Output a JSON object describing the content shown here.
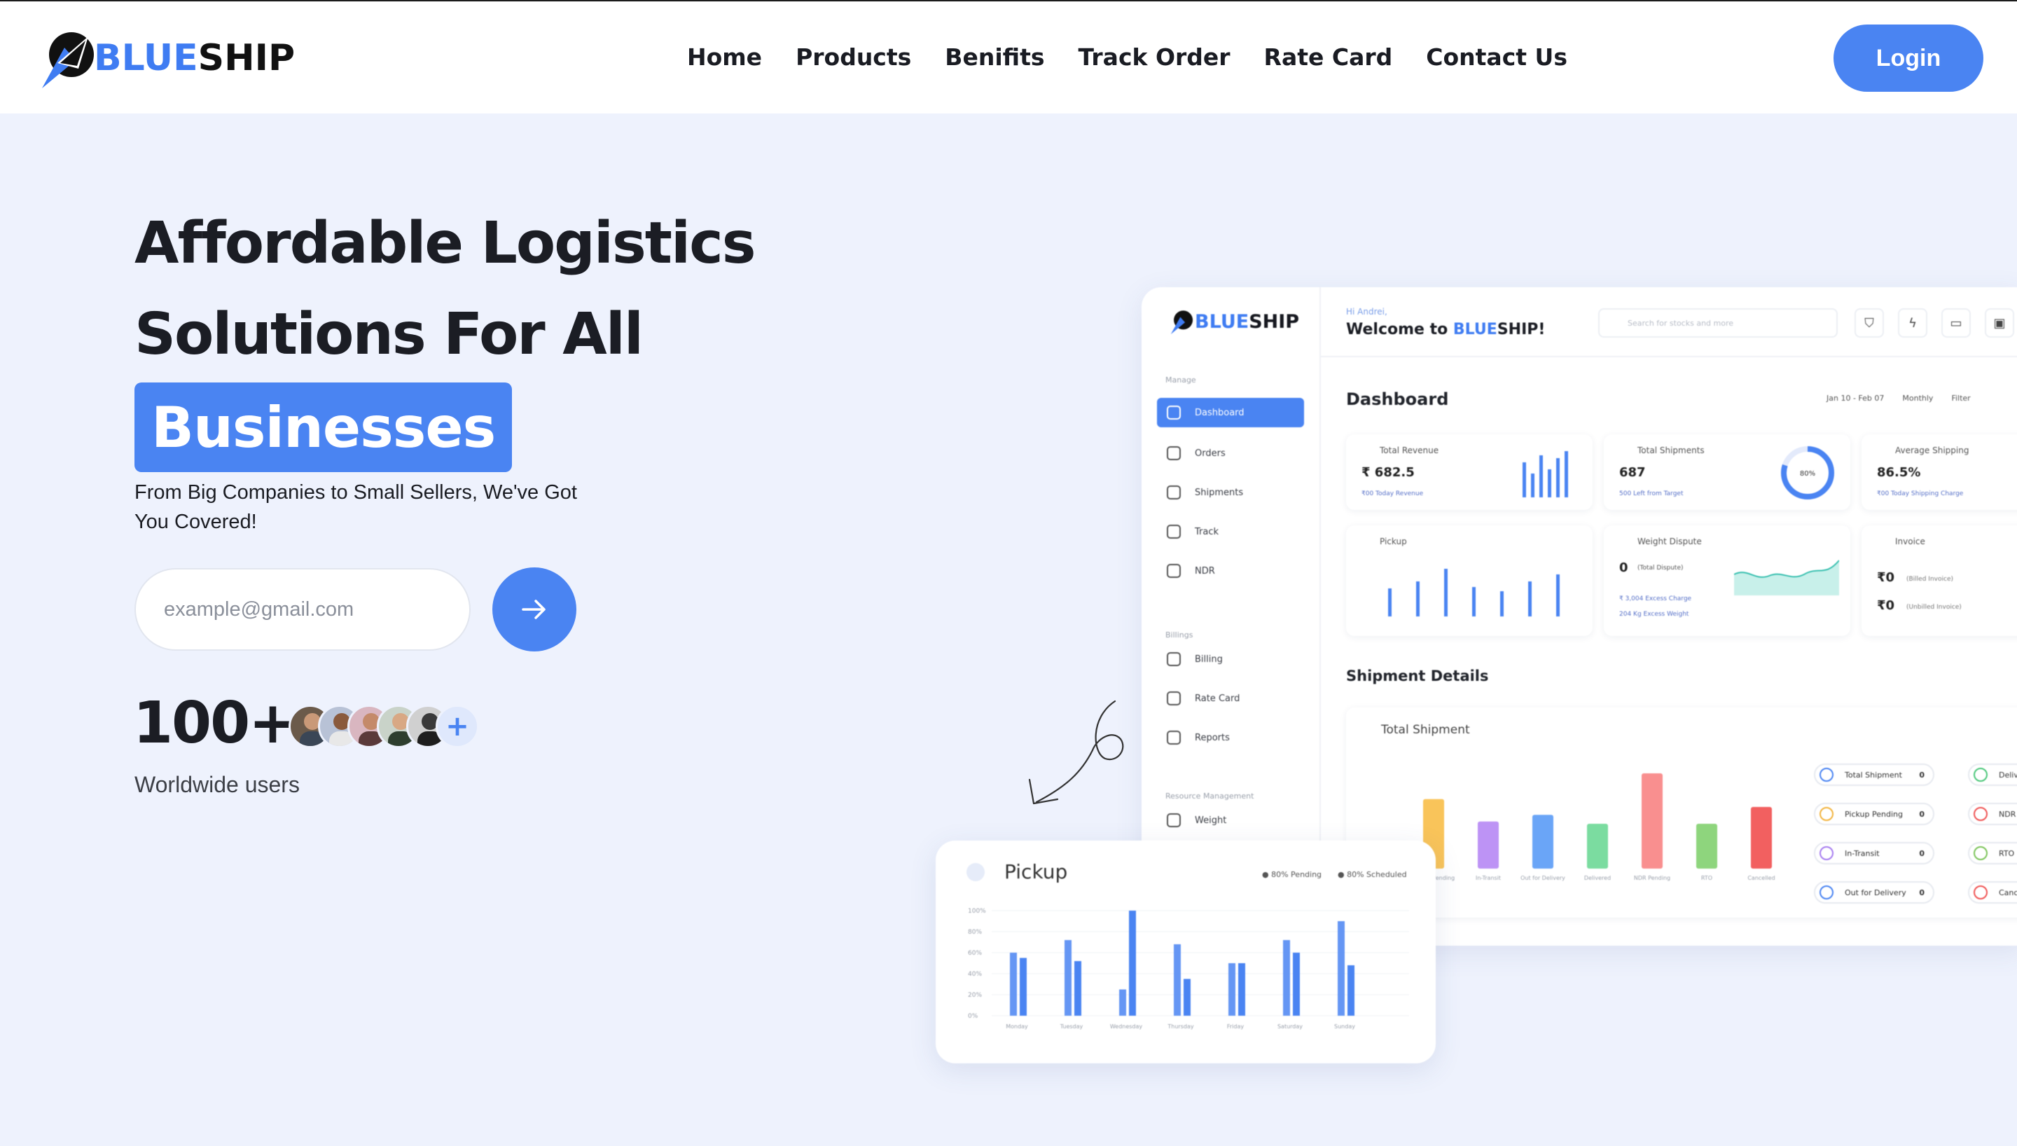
{
  "brand": {
    "part1": "BLUE",
    "part2": "SHIP",
    "accent": "#4a84f2"
  },
  "nav": {
    "items": [
      "Home",
      "Products",
      "Benifits",
      "Track Order",
      "Rate Card",
      "Contact Us"
    ],
    "login": "Login"
  },
  "hero": {
    "line1": "Affordable Logistics",
    "line2": "Solutions For All",
    "highlight": "Businesses",
    "subtitle": "From Big Companies to Small Sellers, We've Got You Covered!",
    "email_placeholder": "example@gmail.com",
    "users_count": "100+",
    "users_label": "Worldwide users",
    "avatar_plus": "+"
  },
  "dashboard": {
    "greeting": "Hi Andrei,",
    "welcome_prefix": "Welcome to ",
    "welcome_brand_blue": "BLUE",
    "welcome_brand_dark": "SHIP!",
    "search_placeholder": "Search for stocks and more",
    "title": "Dashboard",
    "date_range": "Jan 10 - Feb 07",
    "period": "Monthly",
    "filter": "Filter",
    "sidebar": {
      "manage_label": "Manage",
      "items": [
        "Dashboard",
        "Orders",
        "Shipments",
        "Track",
        "NDR"
      ],
      "billings_label": "Billings",
      "billing_items": [
        "Billing",
        "Rate Card",
        "Reports"
      ],
      "resource_label": "Resource Management",
      "resource_items": [
        "Weight"
      ]
    },
    "cards": [
      {
        "label": "Total Revenue",
        "value": "₹ 682.5",
        "sub": "₹00 Today Revenue"
      },
      {
        "label": "Total Shipments",
        "value": "687",
        "sub": "500 Left from Target",
        "ring": "80%"
      },
      {
        "label": "Average Shipping",
        "value": "86.5%",
        "sub": "₹00 Today Shipping Charge"
      },
      {
        "label": "Pickup",
        "value": "",
        "sub": ""
      },
      {
        "label": "Weight Dispute",
        "value": "0",
        "value_note": "(Total Dispute)",
        "sub1": "₹ 3,004 Excess Charge",
        "sub2": "204 Kg Excess Weight"
      },
      {
        "label": "Invoice",
        "value1": "₹0",
        "note1": "(Billed Invoice)",
        "value2": "₹0",
        "note2": "(Unbilled Invoice)"
      }
    ],
    "shipment_details": "Shipment Details",
    "total_shipment_label": "Total Shipment",
    "legend": [
      {
        "name": "Total Shipment",
        "count": "0",
        "color": "#4a84f2"
      },
      {
        "name": "Pickup Pending",
        "count": "0",
        "color": "#f2b33d"
      },
      {
        "name": "In-Transit",
        "count": "0",
        "color": "#a67cf0"
      },
      {
        "name": "Out for Delivery",
        "count": "0",
        "color": "#4a84f2"
      },
      {
        "name": "Delivered",
        "count": "",
        "color": "#4cc77a"
      },
      {
        "name": "NDR Pending",
        "count": "",
        "color": "#f05454"
      },
      {
        "name": "RTO",
        "count": "",
        "color": "#7cc45a"
      },
      {
        "name": "Cancelled",
        "count": "",
        "color": "#f05454"
      }
    ]
  },
  "chart_data": [
    {
      "type": "bar",
      "title": "Total Shipment",
      "categories": [
        "Pickup Pending",
        "In-Transit",
        "Out for Delivery",
        "Delivered",
        "NDR Pending",
        "RTO",
        "Cancelled"
      ],
      "values": [
        62,
        42,
        48,
        40,
        85,
        40,
        55
      ],
      "colors": [
        "#f9c45a",
        "#bd93f5",
        "#6aa5f7",
        "#7bdca0",
        "#f98f8f",
        "#8ed57d",
        "#f26060"
      ]
    },
    {
      "type": "bar",
      "title": "Pickup",
      "categories": [
        "Monday",
        "Tuesday",
        "Wednesday",
        "Thursday",
        "Friday",
        "Saturday",
        "Sunday"
      ],
      "series": [
        {
          "name": "80% Pending",
          "values": [
            60,
            72,
            25,
            68,
            50,
            72,
            90
          ]
        },
        {
          "name": "80% Scheduled",
          "values": [
            55,
            52,
            100,
            35,
            50,
            60,
            48
          ]
        }
      ],
      "yticks": [
        "100%",
        "80%",
        "60%",
        "40%",
        "20%",
        "0%"
      ],
      "ylim": [
        0,
        100
      ]
    }
  ]
}
